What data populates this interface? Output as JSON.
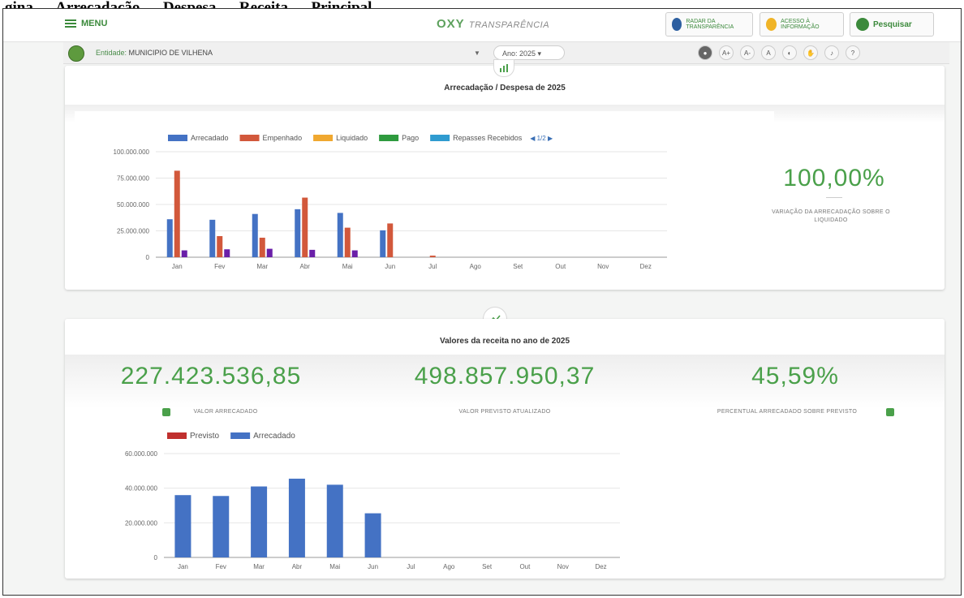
{
  "caption": "gina … Arrecadação … Despesa … Receita … Principal",
  "header": {
    "menu_label": "MENU",
    "brand_main": "OXY",
    "brand_sub": "TRANSPARÊNCIA",
    "btn_radar": "RADAR DA TRANSPARÊNCIA",
    "btn_acesso": "ACESSO À INFORMAÇÃO",
    "btn_pesquisar": "Pesquisar"
  },
  "entity_bar": {
    "entity_label": "Entidade:",
    "entity_name": "MUNICIPIO DE VILHENA",
    "year_label": "Ano: 2025",
    "accessibility": [
      "A+",
      "A-",
      "A",
      "?"
    ]
  },
  "panel1": {
    "title": "Arrecadação / Despesa de 2025",
    "pager": "1/2",
    "kpi_value": "100,00%",
    "kpi_label": "VARIAÇÃO DA ARRECADAÇÃO SOBRE O LIQUIDADO"
  },
  "panel2": {
    "title": "Valores da receita no ano de 2025",
    "kpi1_value": "227.423.536,85",
    "kpi1_label": "VALOR ARRECADADO",
    "kpi2_value": "498.857.950,37",
    "kpi2_label": "VALOR PREVISTO ATUALIZADO",
    "kpi3_value": "45,59%",
    "kpi3_label": "PERCENTUAL ARRECADADO SOBRE PREVISTO"
  },
  "colors": {
    "arrecadado": "#4472c4",
    "empenhado": "#d2583b",
    "liquidado": "#f0a830",
    "pago": "#2e9a3e",
    "repasses": "#2f9bd0",
    "previsto": "#c0302e",
    "accent_green": "#4aa04a"
  },
  "chart_data": [
    {
      "type": "bar",
      "title": "Arrecadação / Despesa de 2025",
      "categories": [
        "Jan",
        "Fev",
        "Mar",
        "Abr",
        "Mai",
        "Jun",
        "Jul",
        "Ago",
        "Set",
        "Out",
        "Nov",
        "Dez"
      ],
      "ylim": [
        0,
        100000000
      ],
      "yticks": [
        0,
        25000000,
        50000000,
        75000000,
        100000000
      ],
      "ytick_labels": [
        "0",
        "25.000.000",
        "50.000.000",
        "75.000.000",
        "100.000.000"
      ],
      "legend_position": "top",
      "series": [
        {
          "name": "Arrecadado",
          "values": [
            36000000,
            35500000,
            41000000,
            45500000,
            42000000,
            25500000,
            0,
            0,
            0,
            0,
            0,
            0
          ]
        },
        {
          "name": "Empenhado",
          "values": [
            82000000,
            20000000,
            18500000,
            56500000,
            28000000,
            32000000,
            1500000,
            0,
            0,
            0,
            0,
            0
          ]
        },
        {
          "name": "Liquidado",
          "values": [
            0,
            0,
            0,
            0,
            0,
            0,
            0,
            0,
            0,
            0,
            0,
            0
          ]
        },
        {
          "name": "Pago",
          "values": [
            0,
            0,
            0,
            0,
            0,
            0,
            0,
            0,
            0,
            0,
            0,
            0
          ]
        },
        {
          "name": "Repasses Recebidos",
          "values": [
            6500000,
            7500000,
            8000000,
            7000000,
            6500000,
            0,
            0,
            0,
            0,
            0,
            0,
            0
          ]
        }
      ]
    },
    {
      "type": "bar",
      "title": "Valores da receita no ano de 2025",
      "categories": [
        "Jan",
        "Fev",
        "Mar",
        "Abr",
        "Mai",
        "Jun",
        "Jul",
        "Ago",
        "Set",
        "Out",
        "Nov",
        "Dez"
      ],
      "ylim": [
        0,
        60000000
      ],
      "yticks": [
        0,
        20000000,
        40000000,
        60000000
      ],
      "ytick_labels": [
        "0",
        "20.000.000",
        "40.000.000",
        "60.000.000"
      ],
      "legend_position": "top-left",
      "series": [
        {
          "name": "Previsto",
          "values": [
            0,
            0,
            0,
            0,
            0,
            0,
            0,
            0,
            0,
            0,
            0,
            0
          ]
        },
        {
          "name": "Arrecadado",
          "values": [
            36000000,
            35500000,
            41000000,
            45500000,
            42000000,
            25500000,
            0,
            0,
            0,
            0,
            0,
            0
          ]
        }
      ]
    }
  ]
}
